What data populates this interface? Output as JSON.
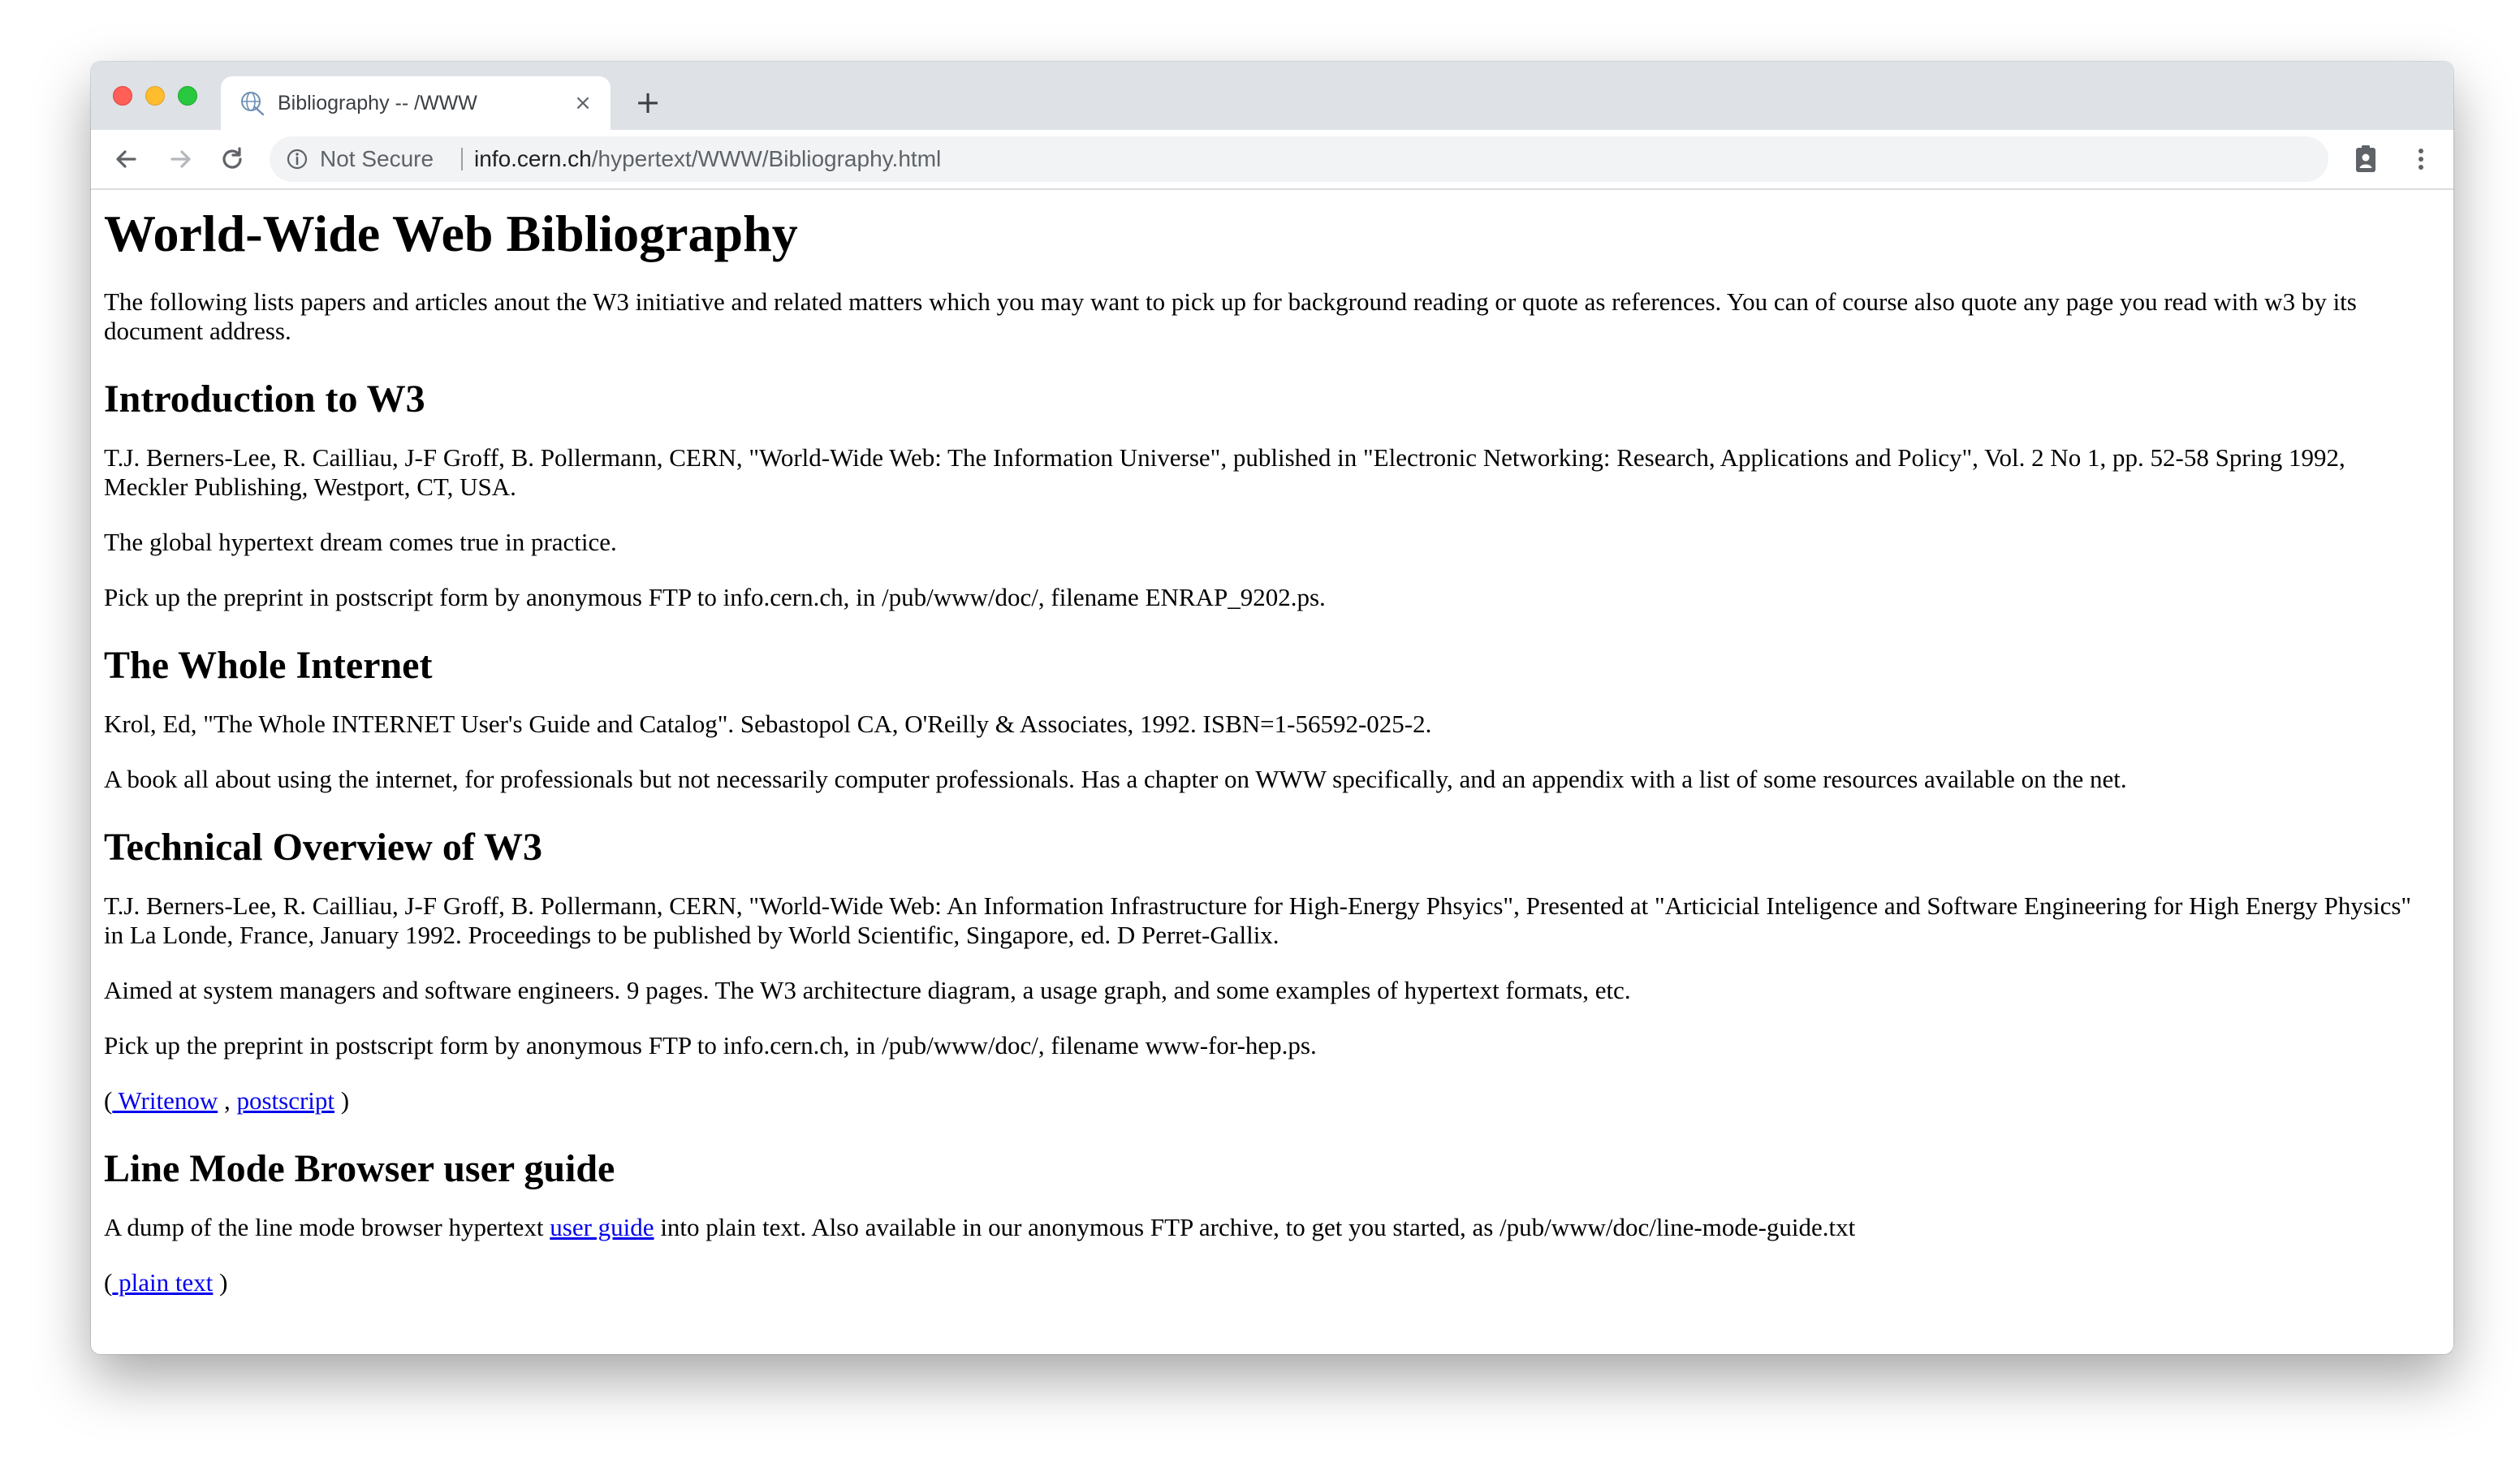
{
  "browser": {
    "tab": {
      "title": "Bibliography -- /WWW",
      "close_glyph": "×"
    },
    "new_tab_glyph": "+",
    "security_label": "Not Secure",
    "url_host": "info.cern.ch",
    "url_path": "/hypertext/WWW/Bibliography.html",
    "icons": {
      "back": "arrow-left-icon",
      "forward": "arrow-right-icon",
      "reload": "reload-icon",
      "info": "info-icon",
      "profile": "badge-icon",
      "menu": "kebab-menu-icon",
      "favicon": "globe-favicon"
    }
  },
  "page": {
    "title": "World-Wide Web Bibliography",
    "intro": "The following lists papers and articles anout the W3 initiative and related matters which you may want to pick up for background reading or quote as references. You can of course also quote any page you read with w3 by its document address.",
    "sections": [
      {
        "heading": "Introduction to W3",
        "p1": "T.J. Berners-Lee, R. Cailliau, J-F Groff, B. Pollermann, CERN, \"World-Wide Web: The Information Universe\", published in \"Electronic Networking: Research, Applications and Policy\", Vol. 2 No 1, pp. 52-58 Spring 1992, Meckler Publishing, Westport, CT, USA.",
        "p2": "The global hypertext dream comes true in practice.",
        "p3": "Pick up the preprint in postscript form by anonymous FTP to info.cern.ch, in /pub/www/doc/, filename ENRAP_9202.ps."
      },
      {
        "heading": "The Whole Internet",
        "p1": "Krol, Ed, \"The Whole INTERNET User's Guide and Catalog\". Sebastopol CA, O'Reilly & Associates, 1992. ISBN=1-56592-025-2.",
        "p2": "A book all about using the internet, for professionals but not necessarily computer professionals. Has a chapter on WWW specifically, and an appendix with a list of some resources available on the net."
      },
      {
        "heading": "Technical Overview of W3",
        "p1": "T.J. Berners-Lee, R. Cailliau, J-F Groff, B. Pollermann, CERN, \"World-Wide Web: An Information Infrastructure for High-Energy Phsyics\", Presented at \"Articicial Inteligence and Software Engineering for High Energy Physics\" in La Londe, France, January 1992. Proceedings to be published by World Scientific, Singapore, ed. D Perret-Gallix.",
        "p2": "Aimed at system managers and software engineers. 9 pages. The W3 architecture diagram, a usage graph, and some examples of hypertext formats, etc.",
        "p3": "Pick up the preprint in postscript form by anonymous FTP to info.cern.ch, in /pub/www/doc/, filename www-for-hep.ps.",
        "links_open": "(",
        "link1": " Writenow",
        "links_sep": " , ",
        "link2": "postscript",
        "links_close": " )"
      },
      {
        "heading": "Line Mode Browser user guide",
        "p1_before": "A dump of the line mode browser hypertext ",
        "p1_link": "user guide",
        "p1_after": " into plain text. Also available in our anonymous FTP archive, to get you started, as /pub/www/doc/line-mode-guide.txt",
        "links_open": "(",
        "link1": " plain text",
        "links_close": " )"
      }
    ]
  },
  "colors": {
    "titlebar": "#dee1e6",
    "link": "#0000ee",
    "text": "#000000",
    "omnibox": "#f1f3f4"
  }
}
